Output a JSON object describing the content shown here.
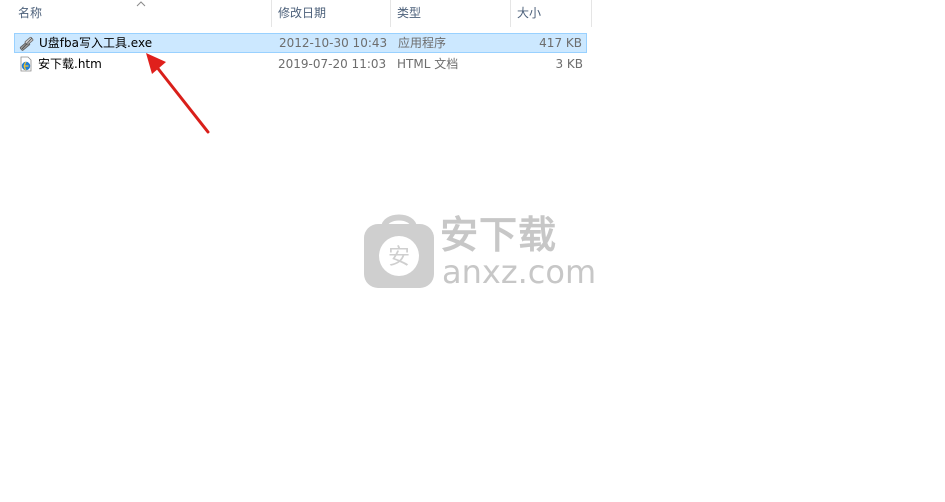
{
  "columns": {
    "name": "名称",
    "date": "修改日期",
    "type": "类型",
    "size": "大小"
  },
  "files": [
    {
      "name": "U盘fba写入工具.exe",
      "date": "2012-10-30 10:43",
      "type": "应用程序",
      "size": "417 KB",
      "icon": "exe-app-icon",
      "selected": true
    },
    {
      "name": "安下载.htm",
      "date": "2019-07-20 11:03",
      "type": "HTML 文档",
      "size": "3 KB",
      "icon": "html-document-icon",
      "selected": false
    }
  ],
  "watermark": {
    "badge_char": "安",
    "title": "安下载",
    "domain": "anxz.com"
  },
  "colors": {
    "selection_bg": "#cce8ff",
    "selection_border": "#99d1ff",
    "header_text": "#4c607a",
    "arrow": "#e0201c",
    "watermark": "#c7c7c7"
  }
}
